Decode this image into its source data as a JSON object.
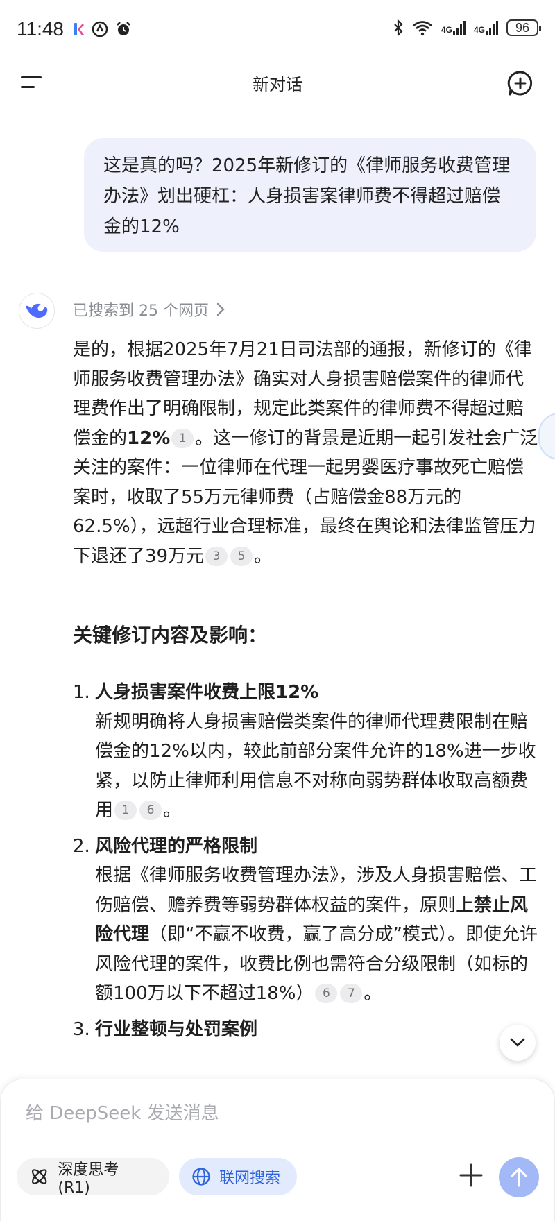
{
  "status_bar": {
    "time": "11:48",
    "signal_1": "4G",
    "signal_2": "4G",
    "battery": "96"
  },
  "header": {
    "title": "新对话"
  },
  "user_message": {
    "text": "这是真的吗？2025年新修订的《律师服务收费管理办法》划出硬杠：人身损害案律师费不得超过赔偿金的12%"
  },
  "assistant": {
    "search_label": "已搜索到 25 个网页",
    "para_1": "是的，根据2025年7月21日司法部的通报，新修订的《律师服务收费管理办法》确实对人身损害赔偿案件的律师代理费作出了明确限制，规定此类案件的律师费不得超过赔偿金的",
    "para_1_bold": "12%",
    "cite_1": "1",
    "para_1_cont": "。这一修订的背景是近期一起引发社会广泛关注的案件：一位律师在代理一起男婴医疗事故死亡赔偿案时，收取了55万元律师费（占赔偿金88万元的62.5%），远超行业合理标准，最终在舆论和法律监管压力下退还了39万元",
    "cite_3": "3",
    "cite_5": "5",
    "para_1_end": "。",
    "section_title": "关键修订内容及影响：",
    "items": [
      {
        "num": "1.",
        "title": "人身损害案件收费上限12%",
        "body": "新规明确将人身损害赔偿类案件的律师代理费限制在赔偿金的12%以内，较此前部分案件允许的18%进一步收紧，以防止律师利用信息不对称向弱势群体收取高额费用",
        "cites": [
          "1",
          "6"
        ],
        "end": "。"
      },
      {
        "num": "2.",
        "title": "风险代理的严格限制",
        "body_pre": "根据《律师服务收费管理办法》，涉及人身损害赔偿、工伤赔偿、赡养费等弱势群体权益的案件，原则上",
        "body_bold": "禁止风险代理",
        "body_post": "（即“不赢不收费，赢了高分成”模式）。即使允许风险代理的案件，收费比例也需符合分级限制（如标的额100万以下不超过18%）",
        "cites": [
          "6",
          "7"
        ],
        "end": "。"
      },
      {
        "num": "3.",
        "title": "行业整顿与处罚案例"
      }
    ]
  },
  "composer": {
    "placeholder": "给 DeepSeek 发送消息",
    "think_label": "深度思考 (R1)",
    "web_label": "联网搜索"
  },
  "colors": {
    "bubble_bg": "#eef1fb",
    "accent": "#2f63d9",
    "send_button": "#a3b8f7"
  },
  "icons": [
    "app-icon-k",
    "app-icon-a",
    "alarm-icon",
    "bluetooth-icon",
    "wifi-icon",
    "menu-icon",
    "new-chat-icon",
    "deepseek-whale-icon",
    "chevron-right-icon",
    "chevron-down-icon",
    "atom-icon",
    "globe-icon",
    "plus-icon",
    "arrow-up-icon"
  ]
}
